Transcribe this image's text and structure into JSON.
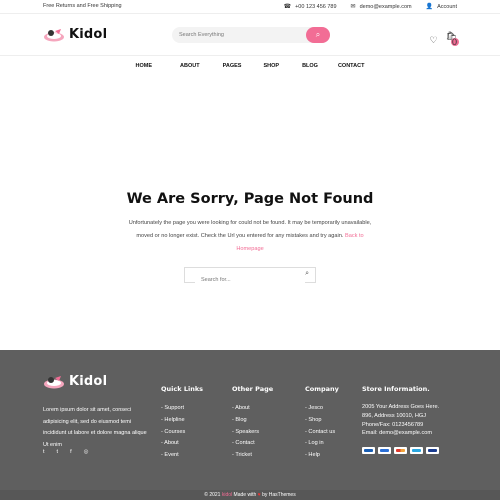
{
  "topbar": {
    "promo": "Free Returns and Free Shipping",
    "phone": "+00 123 456 789",
    "email": "demo@example.com",
    "account": "Account"
  },
  "header": {
    "logo_text": "Kidol",
    "search_placeholder": "Search Everything",
    "cart_count": "0"
  },
  "nav": {
    "items": [
      "HOME",
      "ABOUT",
      "PAGES",
      "SHOP",
      "BLOG",
      "CONTACT"
    ]
  },
  "not_found": {
    "title": "We Are Sorry, Page Not Found",
    "text": "Unfortunately the page you were looking for could not be found. It may be temporarily unavailable, moved or no longer exist. Check the Url you entered for any mistakes and try again.",
    "link_label": "Back to Homepage",
    "search_placeholder": "Search for..."
  },
  "footer": {
    "logo_text": "Kidol",
    "about": "Lorem ipsum dolor sit amet, conseci adipisicing elit, sed do eiusmod temi incididunt ut labore et dolore magna alique Ut enim",
    "social": [
      "t",
      "t",
      "f",
      "◎"
    ],
    "columns": [
      {
        "title": "Quick Links",
        "items": [
          "- Support",
          "- Helpline",
          "- Courses",
          "- About",
          "- Event"
        ]
      },
      {
        "title": "Other Page",
        "items": [
          "- About",
          "- Blog",
          "- Speakers",
          "- Contact",
          "- Tricket"
        ]
      },
      {
        "title": "Company",
        "items": [
          "- Jesco",
          "- Shop",
          "- Contact us",
          "- Log in",
          "- Help"
        ]
      }
    ],
    "store": {
      "title": "Store Information.",
      "lines": [
        "2005 Your Address Goes Here.",
        "896, Address 10010, HGJ",
        "Phone/Fax: 0123456789",
        "Email: demo@example.com"
      ]
    }
  },
  "bottom": {
    "copyright": "© 2021",
    "brand": "kidol",
    "made_with": "Made with",
    "heart": "♥",
    "by": "by HasThemes"
  },
  "colors": {
    "accent": "#f26d95",
    "footer_bg": "#5f5f5f"
  }
}
